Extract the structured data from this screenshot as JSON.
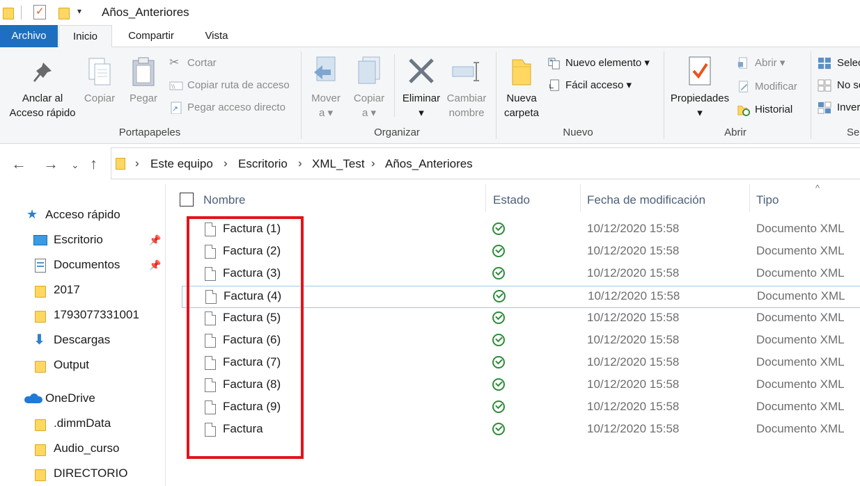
{
  "window": {
    "title": "Años_Anteriores"
  },
  "ribbon_tabs": [
    "Archivo",
    "Inicio",
    "Compartir",
    "Vista"
  ],
  "ribbon": {
    "portapapeles": {
      "label": "Portapapeles",
      "pin_line1": "Anclar al",
      "pin_line2": "Acceso rápido",
      "copy": "Copiar",
      "paste": "Pegar",
      "cut": "Cortar",
      "copy_path": "Copiar ruta de acceso",
      "paste_shortcut": "Pegar acceso directo"
    },
    "organizar": {
      "label": "Organizar",
      "move_line1": "Mover",
      "move_line2": "a ▾",
      "copyto_line1": "Copiar",
      "copyto_line2": "a ▾",
      "delete_line1": "Eliminar",
      "delete_line2": "▾",
      "rename_line1": "Cambiar",
      "rename_line2": "nombre"
    },
    "nuevo": {
      "label": "Nuevo",
      "newfolder_line1": "Nueva",
      "newfolder_line2": "carpeta",
      "new_item": "Nuevo elemento ▾",
      "easy_access": "Fácil acceso ▾"
    },
    "abrir": {
      "label": "Abrir",
      "props_line1": "Propiedades",
      "props_line2": "▾",
      "open": "Abrir ▾",
      "edit": "Modificar",
      "history": "Historial"
    },
    "seleccionar": {
      "label": "Se",
      "select_all": "Selec",
      "select_none": "No se",
      "invert": "Inver"
    }
  },
  "breadcrumb": [
    "Este equipo",
    "Escritorio",
    "XML_Test",
    "Años_Anteriores"
  ],
  "nav_pane": {
    "quick_access": "Acceso rápido",
    "items": [
      {
        "label": "Escritorio",
        "icon": "desktop-icon",
        "pinned": true
      },
      {
        "label": "Documentos",
        "icon": "documents-icon",
        "pinned": true
      },
      {
        "label": "2017",
        "icon": "folder-icon",
        "pinned": false
      },
      {
        "label": "1793077331001",
        "icon": "folder-icon",
        "pinned": false
      },
      {
        "label": "Descargas",
        "icon": "download-icon",
        "pinned": false
      },
      {
        "label": "Output",
        "icon": "folder-icon",
        "pinned": false
      }
    ],
    "onedrive": "OneDrive",
    "onedrive_items": [
      ".dimmData",
      "Audio_curso",
      "DIRECTORIO"
    ]
  },
  "columns": {
    "name": "Nombre",
    "status": "Estado",
    "date": "Fecha de modificación",
    "type": "Tipo"
  },
  "files": [
    {
      "name": "Factura (1)",
      "date": "10/12/2020 15:58",
      "type": "Documento XML"
    },
    {
      "name": "Factura (2)",
      "date": "10/12/2020 15:58",
      "type": "Documento XML"
    },
    {
      "name": "Factura (3)",
      "date": "10/12/2020 15:58",
      "type": "Documento XML"
    },
    {
      "name": "Factura (4)",
      "date": "10/12/2020 15:58",
      "type": "Documento XML"
    },
    {
      "name": "Factura (5)",
      "date": "10/12/2020 15:58",
      "type": "Documento XML"
    },
    {
      "name": "Factura (6)",
      "date": "10/12/2020 15:58",
      "type": "Documento XML"
    },
    {
      "name": "Factura (7)",
      "date": "10/12/2020 15:58",
      "type": "Documento XML"
    },
    {
      "name": "Factura (8)",
      "date": "10/12/2020 15:58",
      "type": "Documento XML"
    },
    {
      "name": "Factura (9)",
      "date": "10/12/2020 15:58",
      "type": "Documento XML"
    },
    {
      "name": "Factura",
      "date": "10/12/2020 15:58",
      "type": "Documento XML"
    }
  ],
  "colors": {
    "file_tab": "#1e6fbf",
    "status_ok": "#2e8b3a",
    "annotation_box": "#e3131b",
    "header_text": "#4c607a"
  }
}
